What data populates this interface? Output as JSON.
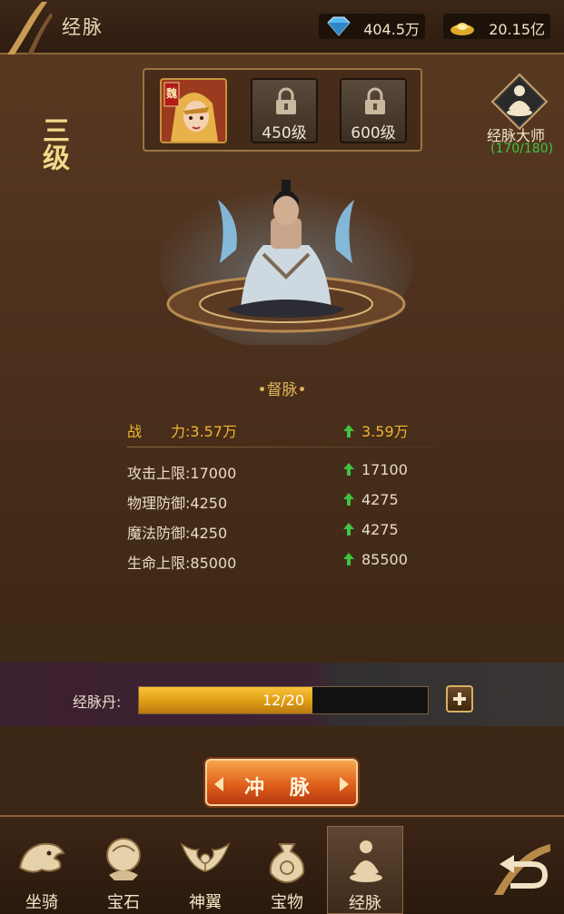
{
  "header": {
    "title": "经脉",
    "diamond": "404.5万",
    "gold": "20.15亿"
  },
  "slots": [
    {
      "badge": "魏"
    },
    {
      "level": "450级"
    },
    {
      "level": "600级"
    }
  ],
  "rank": "三级",
  "master": {
    "label": "经脉大师",
    "count": "(170/180)"
  },
  "vessel_name": "•督脉•",
  "power": {
    "label": "战　　力:",
    "current": "3.57万",
    "next": "3.59万"
  },
  "stats": [
    {
      "label": "攻击上限:",
      "current": "17000",
      "next": "17100"
    },
    {
      "label": "物理防御:",
      "current": "4250",
      "next": "4275"
    },
    {
      "label": "魔法防御:",
      "current": "4250",
      "next": "4275"
    },
    {
      "label": "生命上限:",
      "current": "85000",
      "next": "85500"
    }
  ],
  "pill": {
    "label": "经脉丹:",
    "progress_text": "12/20",
    "progress_fraction": 0.6
  },
  "action_button": "冲 脉",
  "tabs": [
    {
      "label": "坐骑",
      "icon": "mount-icon"
    },
    {
      "label": "宝石",
      "icon": "gem-icon"
    },
    {
      "label": "神翼",
      "icon": "wings-icon"
    },
    {
      "label": "宝物",
      "icon": "treasure-bag-icon"
    },
    {
      "label": "经脉",
      "icon": "meridian-icon",
      "active": true
    }
  ],
  "colors": {
    "gold_text": "#f0b532",
    "green_arrow": "#3fc43f",
    "accent_border": "#8a6436"
  }
}
